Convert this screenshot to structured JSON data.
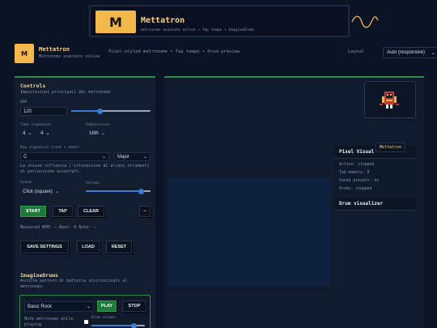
{
  "banner": {
    "logo_letter": "M",
    "title": "Mettatron",
    "subtitle": "metronome avanzato online • Tap tempo • ImagineDrums"
  },
  "header": {
    "logo_letter": "M",
    "title": "Mettatron",
    "subtitle": "Metronomo avanzato online",
    "tagline": "Pixel-styled metronome • Tap tempo • Drum preview",
    "layout_label": "Layout",
    "layout_value": "Auto (responsive)"
  },
  "controls": {
    "title": "Controls",
    "description": "Impostazioni principali del metronomo",
    "bpm_label": "BPM",
    "bpm_value": "120",
    "bpm_level": 0.36,
    "time_signature_label": "Time signature",
    "ts_num": "4",
    "ts_den": "4",
    "subdivision_label": "Subdivision",
    "subdivision_value": "16th",
    "key_label": "Key signature (root + mode)",
    "key_root": "C",
    "key_mode": "Major",
    "key_help": "La chiave influenza l'intonazione di alcuni strumenti di percussione accentati.",
    "sound_label": "Sound",
    "sound_value": "Click (square)",
    "volume_label": "Volume",
    "volume_level": 0.85,
    "start_label": "START",
    "tap_label": "TAP",
    "clear_label": "CLEAR",
    "minus_label": "−",
    "measured_text": "Measured BPM: —   Beat: 0   Note: —",
    "save_label": "SAVE SETTINGS",
    "load_label": "LOAD",
    "reset_label": "RESET"
  },
  "drums": {
    "title": "ImagineDrums",
    "description": "Ascolta pattern di batteria sincronizzati al metronomo.",
    "pattern_value": "Basic Rock",
    "play_label": "PLAY",
    "stop_label": "STOP",
    "mute_label": "Mute metronome while playing",
    "drum_volume_label": "Drum volume",
    "drum_volume_level": 0.8
  },
  "visual": {
    "badge": "Mettatron",
    "pixel_visual_title": "Pixel Visual",
    "rows": [
      "Active: stopped",
      "Tap memory: 0",
      "Saved presets: no",
      "Drums: stopped"
    ],
    "drum_visualizer_title": "Drum visualizer"
  },
  "colors": {
    "accent_gold": "#f2b84b",
    "accent_green": "#2e8b4a",
    "accent_blue": "#3a7bd5",
    "background": "#0b1424"
  }
}
